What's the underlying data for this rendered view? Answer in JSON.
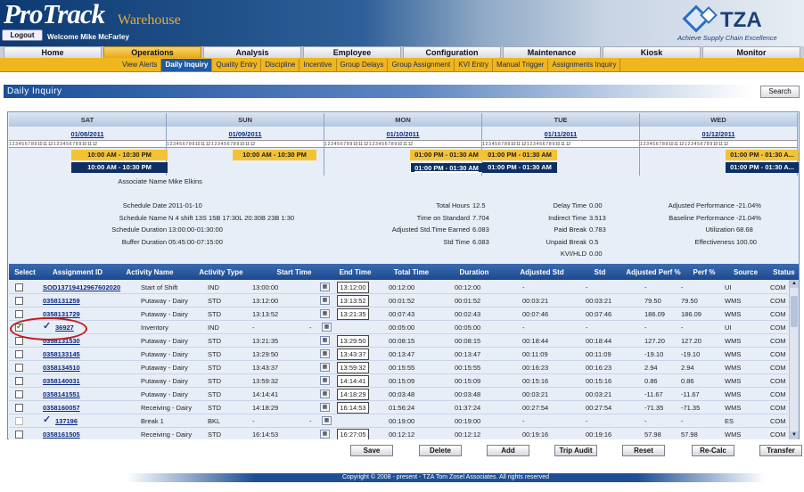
{
  "header": {
    "brand": "ProTrack",
    "brand_sub": "Warehouse",
    "logout_label": "Logout",
    "welcome": "Welcome Mike McFarley",
    "logo_text": "TZA",
    "tagline": "Achieve Supply Chain Excellence"
  },
  "nav": {
    "tabs": [
      "Home",
      "Operations",
      "Analysis",
      "Employee",
      "Configuration",
      "Maintenance",
      "Kiosk",
      "Monitor"
    ],
    "active": "Operations"
  },
  "subnav": {
    "items": [
      "View Alerts",
      "Daily Inquiry",
      "Quality Entry",
      "Discipline",
      "Incentive",
      "Group Delays",
      "Group Assignment",
      "KVI Entry",
      "Manual Trigger",
      "Assignments Inquiry"
    ],
    "active": "Daily Inquiry"
  },
  "page": {
    "title": "Daily Inquiry",
    "search_label": "Search"
  },
  "days": [
    {
      "name": "SAT",
      "date": "01/08/2011",
      "shift_yellow": "10:00 AM - 10:30 PM",
      "shift_blue": "10:00 AM - 10:30 PM"
    },
    {
      "name": "SUN",
      "date": "01/09/2011",
      "shift_yellow": "10:00 AM - 10:30 PM",
      "shift_blue": ""
    },
    {
      "name": "MON",
      "date": "01/10/2011",
      "shift_yellow": "01:00 PM - 01:30 AM",
      "shift_blue": "01:00 PM - 01:30 AM"
    },
    {
      "name": "TUE",
      "date": "01/11/2011",
      "shift_yellow": "01:00 PM - 01:30 AM",
      "shift_blue": "01:00 PM - 01:30 AM"
    },
    {
      "name": "WED",
      "date": "01/12/2011",
      "shift_yellow": "01:00 PM - 01:30 A...",
      "shift_blue": "01:00 PM - 01:30 A..."
    }
  ],
  "ruler_text": "1 2 3 4 5 6 7 8 9 10 11 12 1 2 3 4 5 6 7 8 9 10 11 12",
  "summary": {
    "associate_name_label": "Associate Name",
    "associate_name": "Mike Elkins",
    "col1": [
      [
        "Schedule Date",
        "2011-01-10"
      ],
      [
        "Schedule Name",
        "N 4 shift 13S 15B 17:30L 20:30B 23B 1:30"
      ],
      [
        "Schedule Duration",
        "13:00:00-01:30:00"
      ],
      [
        "Buffer Duration",
        "05:45:00-07:15:00"
      ]
    ],
    "col2": [
      [
        "Total Hours",
        "12.5"
      ],
      [
        "Time on Standard",
        "7.704"
      ],
      [
        "Adjusted Std.Time Earned",
        "6.083"
      ],
      [
        "Std Time",
        "6.083"
      ]
    ],
    "col3": [
      [
        "Delay Time",
        "0.00"
      ],
      [
        "Indirect Time",
        "3.513"
      ],
      [
        "Paid Break",
        "0.783"
      ],
      [
        "Unpaid Break",
        "0.5"
      ],
      [
        "KVI/HLD",
        "0.00"
      ]
    ],
    "col4": [
      [
        "Adjusted Performance",
        "-21.04%"
      ],
      [
        "Baseline Performance",
        "-21.04%"
      ],
      [
        "Utilization",
        "68.68"
      ],
      [
        "Effectiveness",
        "100.00"
      ]
    ]
  },
  "table": {
    "headers": [
      "Select",
      "Assignment ID",
      "Activity Name",
      "Activity Type",
      "Start Time",
      "End Time",
      "Total Time",
      "Duration",
      "Adjusted Std",
      "Std",
      "Adjusted Perf %",
      "Perf %",
      "Source",
      "Status"
    ],
    "rows": [
      {
        "checked": false,
        "id": "SOD13719412967602020",
        "activity": "Start of Shift",
        "type": "IND",
        "start": "13:00:00",
        "end": "13:12:00",
        "total": "00:12:00",
        "dur": "00:12:00",
        "adjstd": "-",
        "std": "-",
        "adjperf": "-",
        "perf": "-",
        "source": "UI",
        "status": "COM"
      },
      {
        "checked": false,
        "id": "0358131259",
        "activity": "Putaway - Dairy",
        "type": "STD",
        "start": "13:12:00",
        "end": "13:13:52",
        "total": "00:01:52",
        "dur": "00:01:52",
        "adjstd": "00:03:21",
        "std": "00:03:21",
        "adjperf": "79.50",
        "perf": "79.50",
        "source": "WMS",
        "status": "COM"
      },
      {
        "checked": false,
        "id": "0358131729",
        "activity": "Putaway - Dairy",
        "type": "STD",
        "start": "13:13:52",
        "end": "13:21:35",
        "total": "00:07:43",
        "dur": "00:02:43",
        "adjstd": "00:07:46",
        "std": "00:07:46",
        "adjperf": "186.09",
        "perf": "186.09",
        "source": "WMS",
        "status": "COM"
      },
      {
        "checked": true,
        "id": "36927",
        "activity": "Inventory",
        "type": "IND",
        "start": "-",
        "end": "",
        "total": "00:05:00",
        "dur": "00:05:00",
        "adjstd": "-",
        "std": "-",
        "adjperf": "-",
        "perf": "-",
        "source": "UI",
        "status": "COM"
      },
      {
        "checked": false,
        "id": "0358131530",
        "activity": "Putaway - Dairy",
        "type": "STD",
        "start": "13:21:35",
        "end": "13:29:50",
        "total": "00:08:15",
        "dur": "00:08:15",
        "adjstd": "00:18:44",
        "std": "00:18:44",
        "adjperf": "127.20",
        "perf": "127.20",
        "source": "WMS",
        "status": "COM"
      },
      {
        "checked": false,
        "id": "0358133145",
        "activity": "Putaway - Dairy",
        "type": "STD",
        "start": "13:29:50",
        "end": "13:43:37",
        "total": "00:13:47",
        "dur": "00:13:47",
        "adjstd": "00:11:09",
        "std": "00:11:09",
        "adjperf": "-19.10",
        "perf": "-19.10",
        "source": "WMS",
        "status": "COM"
      },
      {
        "checked": false,
        "id": "0358134510",
        "activity": "Putaway - Dairy",
        "type": "STD",
        "start": "13:43:37",
        "end": "13:59:32",
        "total": "00:15:55",
        "dur": "00:15:55",
        "adjstd": "00:16:23",
        "std": "00:16:23",
        "adjperf": "2.94",
        "perf": "2.94",
        "source": "WMS",
        "status": "COM"
      },
      {
        "checked": false,
        "id": "0358140031",
        "activity": "Putaway - Dairy",
        "type": "STD",
        "start": "13:59:32",
        "end": "14:14:41",
        "total": "00:15:09",
        "dur": "00:15:09",
        "adjstd": "00:15:16",
        "std": "00:15:16",
        "adjperf": "0.86",
        "perf": "0.86",
        "source": "WMS",
        "status": "COM"
      },
      {
        "checked": false,
        "id": "0358141551",
        "activity": "Putaway - Dairy",
        "type": "STD",
        "start": "14:14:41",
        "end": "14:18:29",
        "total": "00:03:48",
        "dur": "00:03:48",
        "adjstd": "00:03:21",
        "std": "00:03:21",
        "adjperf": "-11.67",
        "perf": "-11.67",
        "source": "WMS",
        "status": "COM"
      },
      {
        "checked": false,
        "id": "0358160057",
        "activity": "Receiving - Dairy",
        "type": "STD",
        "start": "14:18:29",
        "end": "16:14:53",
        "total": "01:56:24",
        "dur": "01:37:24",
        "adjstd": "00:27:54",
        "std": "00:27:54",
        "adjperf": "-71.35",
        "perf": "-71.35",
        "source": "WMS",
        "status": "COM"
      },
      {
        "checked": false,
        "disabled": true,
        "id": "137196",
        "activity": "Break 1",
        "type": "BKL",
        "start": "-",
        "end": "",
        "total": "00:19:00",
        "dur": "00:19:00",
        "adjstd": "-",
        "std": "-",
        "adjperf": "-",
        "perf": "-",
        "source": "ES",
        "status": "COM"
      },
      {
        "checked": false,
        "id": "0358161505",
        "activity": "Receiving - Dairy",
        "type": "STD",
        "start": "16:14:53",
        "end": "16:27:05",
        "total": "00:12:12",
        "dur": "00:12:12",
        "adjstd": "00:19:16",
        "std": "00:19:16",
        "adjperf": "57.98",
        "perf": "57.98",
        "source": "WMS",
        "status": "COM"
      }
    ]
  },
  "buttons": [
    "Save",
    "Delete",
    "Add",
    "Trip Audit",
    "Reset",
    "Re-Calc",
    "Transfer"
  ],
  "footer": "Copyright © 2008 - present - TZA Tom Zosel Associates.  All rights reserved"
}
